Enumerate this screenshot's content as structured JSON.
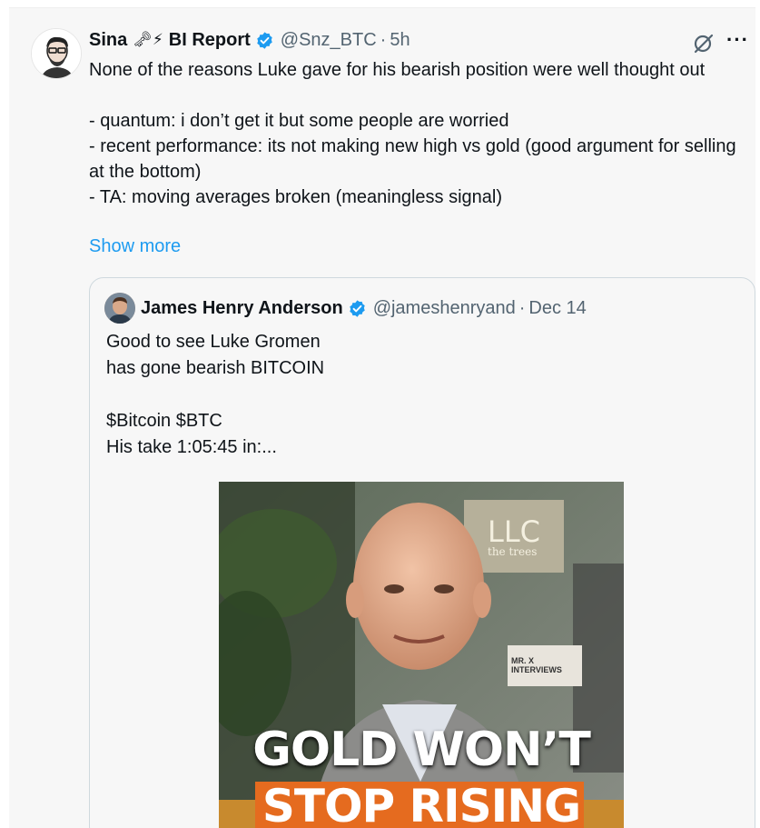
{
  "tweet": {
    "display_name": "Sina",
    "name_emoji": "🗝⚡",
    "name_suffix": "BI Report",
    "handle": "@Snz_BTC",
    "separator": "·",
    "time": "5h",
    "text_lines": [
      "None of the reasons Luke gave for his bearish position were well thought out",
      "- quantum: i don’t get it but some people are worried",
      "- recent performance: its not making new high vs gold (good argument for selling at the bottom)",
      "- TA: moving averages broken (meaningless signal)"
    ],
    "show_more": "Show more"
  },
  "quote": {
    "display_name": "James Henry Anderson",
    "handle": "@jameshenryand",
    "separator": "·",
    "date": "Dec 14",
    "text_lines": [
      "Good to see Luke Gromen",
      "has gone bearish BITCOIN",
      "$Bitcoin $BTC",
      "His take 1:05:45 in:..."
    ],
    "media": {
      "caption_line1": "GOLD WON’T",
      "caption_line2": "STOP RISING",
      "sign_text": "LLC",
      "sign_subtext": "the trees",
      "badge_text": "MR. X INTERVIEWS"
    }
  },
  "colors": {
    "accent": "#1d9bf0",
    "muted": "#536471",
    "border": "#cfd9de",
    "caption_bg": "#e56b1f"
  },
  "icons": [
    "verified-badge-icon",
    "grok-icon",
    "more-icon"
  ]
}
